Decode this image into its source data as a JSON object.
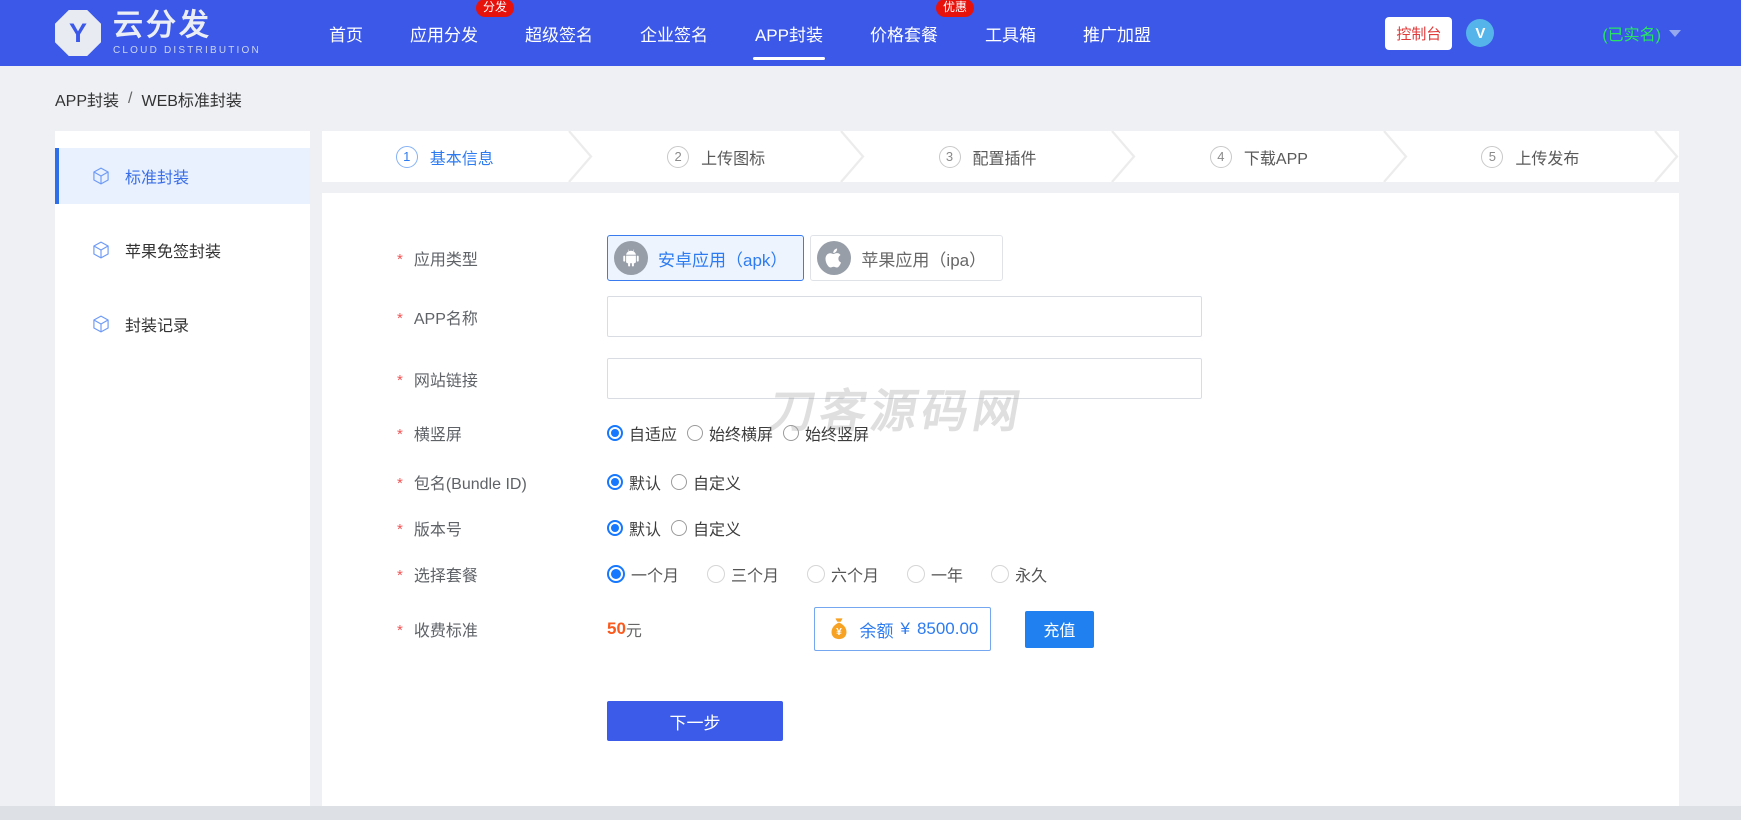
{
  "brand": {
    "logo_letter": "Y",
    "name": "云分发",
    "subtitle": "CLOUD DISTRIBUTION"
  },
  "navbar": {
    "items": [
      {
        "label": "首页"
      },
      {
        "label": "应用分发",
        "badge": "分发"
      },
      {
        "label": "超级签名"
      },
      {
        "label": "企业签名"
      },
      {
        "label": "APP封装"
      },
      {
        "label": "价格套餐",
        "badge": "优惠"
      },
      {
        "label": "工具箱"
      },
      {
        "label": "推广加盟"
      }
    ],
    "active_item": "APP封装",
    "console_button": "控制台",
    "avatar_letter": "V",
    "user_status": "(已实名)"
  },
  "breadcrumb": {
    "section": "APP封装",
    "separator": "/",
    "page": "WEB标准封装"
  },
  "sidebar": {
    "active_item": "标准封装",
    "items": [
      {
        "label": "标准封装"
      },
      {
        "label": "苹果免签封装"
      },
      {
        "label": "封装记录"
      }
    ]
  },
  "steps": [
    {
      "num": "1",
      "label": "基本信息",
      "active": true
    },
    {
      "num": "2",
      "label": "上传图标",
      "active": false
    },
    {
      "num": "3",
      "label": "配置插件",
      "active": false
    },
    {
      "num": "4",
      "label": "下载APP",
      "active": false
    },
    {
      "num": "5",
      "label": "上传发布",
      "active": false
    }
  ],
  "form": {
    "required_marker": "*",
    "app_type": {
      "label": "应用类型",
      "selected": "安卓应用（apk）",
      "options": [
        {
          "label": "安卓应用（apk）",
          "icon": "android-icon"
        },
        {
          "label": "苹果应用（ipa）",
          "icon": "apple-icon"
        }
      ]
    },
    "app_name": {
      "label": "APP名称",
      "value": "",
      "placeholder": ""
    },
    "site_url": {
      "label": "网站链接",
      "value": "",
      "placeholder": ""
    },
    "orientation": {
      "label": "横竖屏",
      "selected": "自适应",
      "options": [
        "自适应",
        "始终横屏",
        "始终竖屏"
      ]
    },
    "bundle_id": {
      "label": "包名(Bundle ID)",
      "selected": "默认",
      "options": [
        "默认",
        "自定义"
      ]
    },
    "version": {
      "label": "版本号",
      "selected": "默认",
      "options": [
        "默认",
        "自定义"
      ]
    },
    "plan": {
      "label": "选择套餐",
      "selected": "一个月",
      "options": [
        "一个月",
        "三个月",
        "六个月",
        "一年",
        "永久"
      ]
    },
    "price": {
      "label": "收费标准",
      "amount": "50",
      "unit": "元",
      "balance_label": "余额",
      "balance_currency": "¥",
      "balance_amount": "8500.00",
      "recharge_button": "充值"
    },
    "next_button": "下一步"
  },
  "watermark": "刀客源码网",
  "colors": {
    "navbar_blue": "#3b58e8",
    "primary_blue": "#2d7bf0",
    "badge_red": "#e8120c",
    "verified_green": "#27e465",
    "price_orange": "#fa5a1e",
    "active_item_bg": "#e8f1fd"
  }
}
